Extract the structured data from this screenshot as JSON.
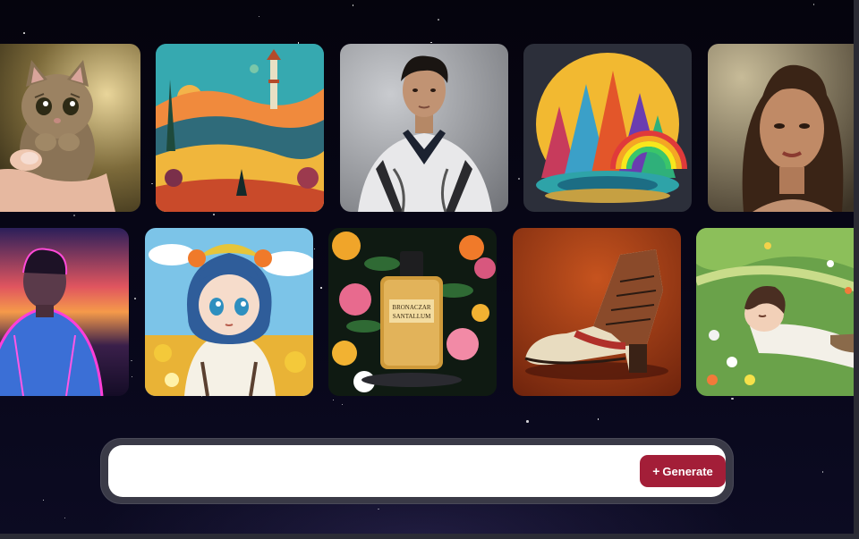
{
  "gallery": {
    "row1": [
      {
        "subject": "kitten-held-in-hand"
      },
      {
        "subject": "colorful-landscape-with-tower"
      },
      {
        "subject": "man-portrait-in-jacket"
      },
      {
        "subject": "geometric-rainbow-mountains"
      },
      {
        "subject": "woman-portrait"
      }
    ],
    "row2": [
      {
        "subject": "neon-cyberpunk-man"
      },
      {
        "subject": "anime-girl-with-flowers"
      },
      {
        "subject": "perfume-bottle-in-flowers"
      },
      {
        "subject": "leather-high-heel-boot"
      },
      {
        "subject": "anime-girl-lying-in-flower-field"
      }
    ],
    "perfume_label_line1": "BRONACZAR",
    "perfume_label_line2": "SANTALLUM"
  },
  "prompt": {
    "value": "",
    "placeholder": "",
    "generate_label": "Generate",
    "generate_icon": "plus-icon"
  },
  "colors": {
    "background": "#07060f",
    "generate_button": "#a31e38",
    "prompt_frame": "#3a3a47"
  }
}
